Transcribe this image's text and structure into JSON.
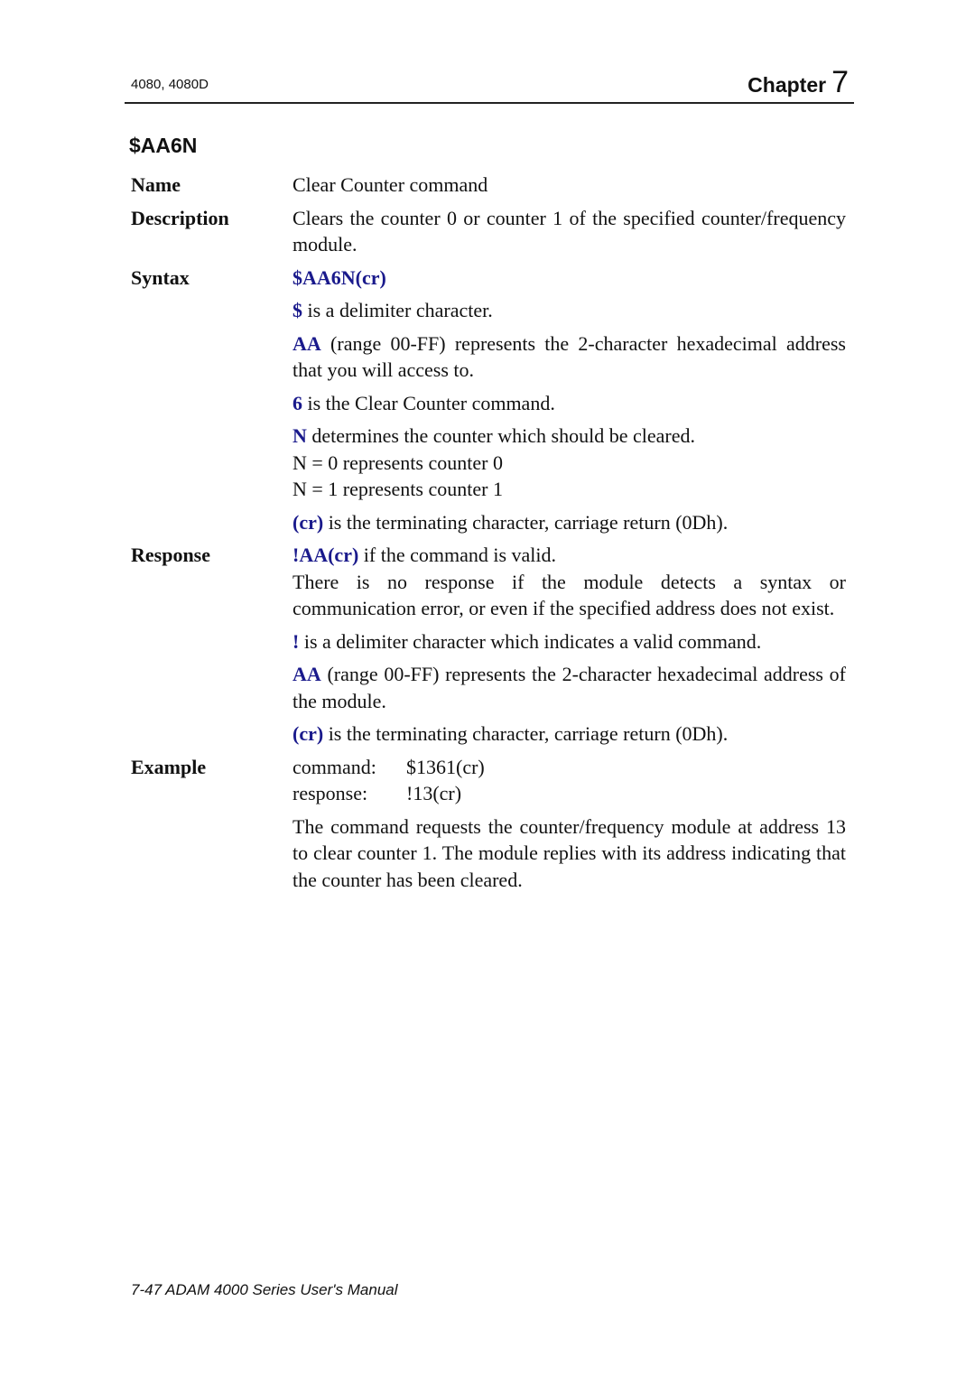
{
  "header": {
    "model": "4080, 4080D",
    "chapter_label": "Chapter",
    "chapter_number": "7"
  },
  "command_title": "$AA6N",
  "sections": {
    "name": {
      "label": "Name",
      "text": "Clear Counter command"
    },
    "description": {
      "label": "Description",
      "text": "Clears the counter 0 or counter 1 of the specified counter/frequency module."
    },
    "syntax": {
      "label": "Syntax",
      "format": "$AA6N(cr)",
      "items": [
        {
          "key": "$",
          "text": " is a delimiter character."
        },
        {
          "key": "AA",
          "text": " (range 00-FF) represents the 2-character hexadecimal address that you will access to."
        },
        {
          "key": "6",
          "text": " is the Clear Counter command."
        },
        {
          "key": "N",
          "text": " determines the counter which should be cleared.",
          "sub": [
            "N = 0 represents counter 0",
            "N = 1 represents counter 1"
          ]
        },
        {
          "key": "(cr)",
          "text": " is the terminating character, carriage return (0Dh)."
        }
      ]
    },
    "response": {
      "label": "Response",
      "format": "!AA(cr)",
      "format_suffix": " if the command is valid.",
      "note": "There is no response if the module detects a syntax or communication error, or even if the specified address does not exist.",
      "items": [
        {
          "key": "!",
          "text": " is a delimiter character which indicates a valid command."
        },
        {
          "key": "AA",
          "text": " (range 00-FF) represents the 2-character hexadecimal address of the module."
        },
        {
          "key": "(cr)",
          "text": " is the terminating character, carriage return (0Dh)."
        }
      ]
    },
    "example": {
      "label": "Example",
      "command_key": "command:",
      "command_value": "$1361(cr)",
      "response_key": "response:",
      "response_value": "!13(cr)",
      "explanation": "The command requests the counter/frequency module at address 13 to clear counter 1. The module replies with its address indicating that the counter has been cleared."
    }
  },
  "footer": "7-47 ADAM 4000 Series User's Manual"
}
